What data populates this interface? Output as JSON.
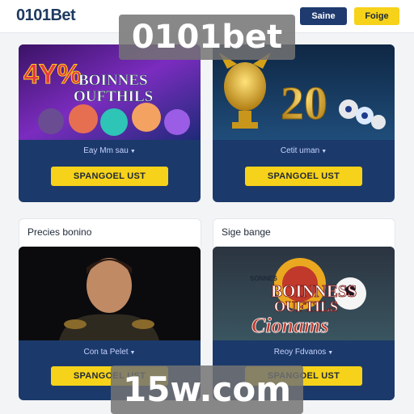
{
  "header": {
    "logo": "0101Bet",
    "nav": [
      "",
      "",
      ""
    ],
    "signin_label": "Saine",
    "join_label": "Foige"
  },
  "watermark": {
    "top": "0101bet",
    "bottom": "15w.com"
  },
  "cards": [
    {
      "hero_text": [
        "4Y%",
        "BOINNES",
        "OUFTHILS"
      ],
      "sub": "Eay Mm sau",
      "cta": "SPANGOEL UST"
    },
    {
      "hero_text": [
        "20"
      ],
      "sub": "Cetit uman",
      "cta": "SPANGOEL UST"
    },
    {
      "hero_text": [],
      "sub": "Con ta Pelet",
      "cta": "SPANGOEL UST"
    },
    {
      "hero_text": [
        "SONNES",
        "BOINNESS",
        "OUFTILS",
        "Cionams"
      ],
      "sub": "Reoy Fdvanos",
      "cta": "SPANGOEL UST"
    }
  ],
  "sections": {
    "left": "Precies bonino",
    "right": "Sige bange"
  },
  "colors": {
    "card_bg": "#1b3a6b",
    "accent": "#f7d21a",
    "header_button": "#1e3a6e"
  }
}
